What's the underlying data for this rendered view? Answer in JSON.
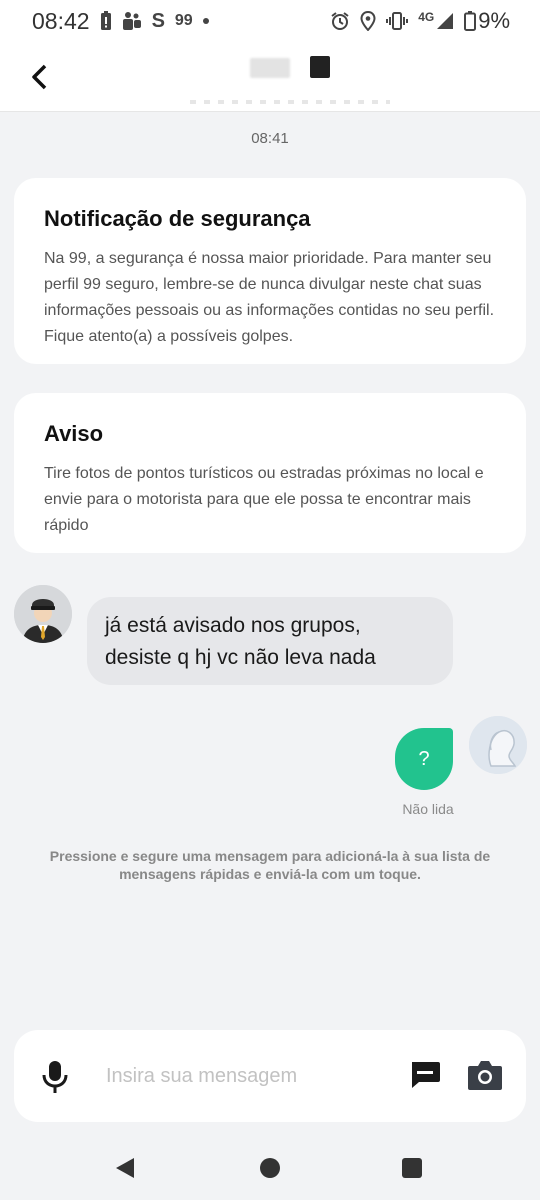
{
  "status_bar": {
    "time": "08:42",
    "carrier_glyph": "S",
    "app_badge": "99",
    "network": "4G",
    "battery": "9%"
  },
  "header": {
    "back_icon": "chevron-left-icon"
  },
  "chat": {
    "timestamp": "08:41",
    "security_notice": {
      "title": "Notificação de segurança",
      "body": "Na 99, a segurança é nossa maior prioridade. Para manter seu perfil 99 seguro, lembre-se de nunca divulgar neste chat suas informações pessoais ou as informações contidas no seu perfil. Fique atento(a) a possíveis golpes."
    },
    "notice": {
      "title": "Aviso",
      "body": "Tire fotos de pontos turísticos ou estradas próximas no local e envie para o motorista para que ele possa te encontrar mais rápido"
    },
    "incoming_message": {
      "line1": "já está avisado nos grupos,",
      "line2": "desiste q hj vc não leva nada"
    },
    "outgoing_message": {
      "text": "?",
      "status": "Não lida"
    },
    "hint": "Pressione e segure uma mensagem para adicioná-la à sua lista de mensagens rápidas e enviá-la com um toque."
  },
  "input": {
    "placeholder": "Insira sua mensagem"
  },
  "colors": {
    "accent": "#22c38e",
    "background": "#f2f3f5",
    "incoming_bubble": "#e6e7ea"
  }
}
